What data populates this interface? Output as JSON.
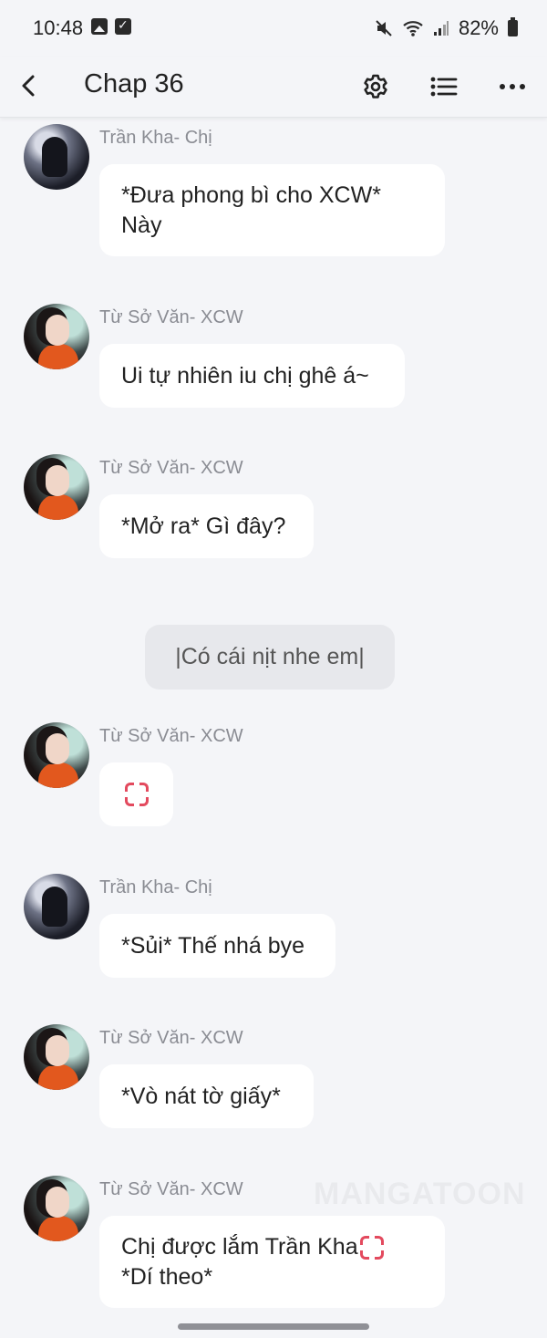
{
  "status_bar": {
    "time": "10:48",
    "battery": "82%"
  },
  "header": {
    "title": "Chap 36"
  },
  "messages": [
    {
      "sender": "Trần Kha- Chị",
      "lines": [
        "*Đưa phong bì cho XCW*",
        "Này"
      ]
    },
    {
      "sender": "Từ Sở Văn- XCW",
      "lines": [
        "Ui tự nhiên iu chị ghê á~"
      ]
    },
    {
      "sender": "Từ Sở Văn- XCW",
      "lines": [
        "*Mở ra* Gì đây?"
      ]
    },
    {
      "sender": "Từ Sở Văn- XCW",
      "lines": [],
      "emoji": "anger-symbol"
    },
    {
      "sender": "Trần Kha- Chị",
      "lines": [
        "*Sủi* Thế nhá bye"
      ]
    },
    {
      "sender": "Từ Sở Văn- XCW",
      "lines": [
        "*Vò nát tờ giấy*"
      ]
    },
    {
      "sender": "Từ Sở Văn- XCW",
      "lines": [
        "Chị được lắm Trần Kha",
        "*Dí theo*"
      ],
      "emoji": "anger-symbol"
    }
  ],
  "narration": "|Có cái nịt nhe em|",
  "watermark": "MANGATOON",
  "colors": {
    "background": "#f4f5f8",
    "bubble": "#ffffff",
    "narration_bubble": "#e7e8ec",
    "sender_text": "#8a8c93",
    "anger_emoji": "#e34a5e"
  },
  "icons": [
    "back-arrow-icon",
    "gear-icon",
    "list-icon",
    "more-icon",
    "anger-emoji-icon"
  ]
}
